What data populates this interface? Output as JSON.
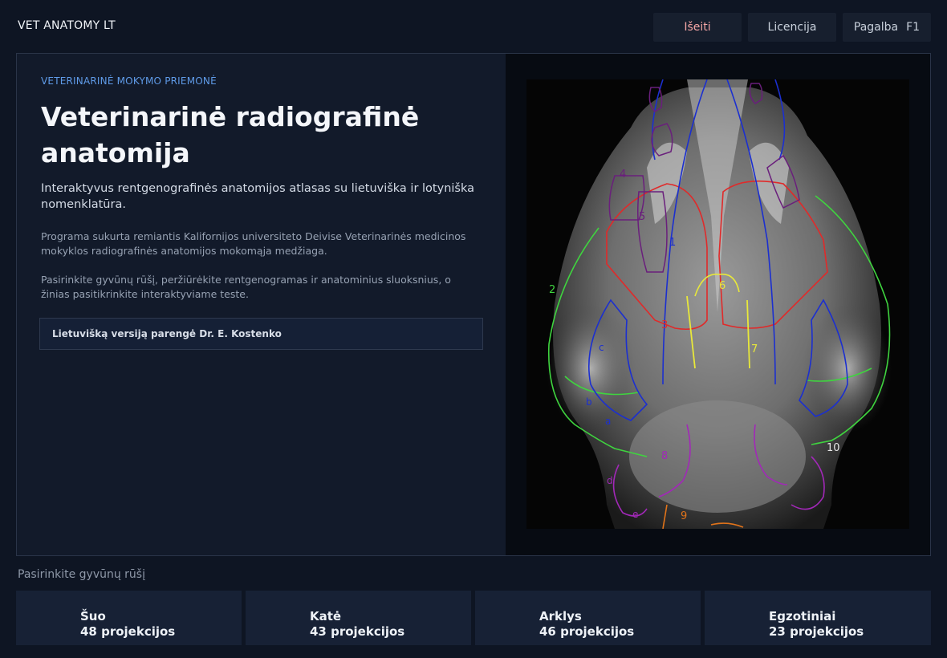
{
  "app": {
    "title": "VET ANATOMY LT"
  },
  "toolbar": {
    "exit_label": "Išeiti",
    "license_label": "Licencija",
    "help_label": "Pagalba",
    "help_key": "F1"
  },
  "intro": {
    "eyebrow": "VETERINARINĖ MOKYMO PRIEMONĖ",
    "title": "Veterinarinė radiografinė anatomija",
    "lead": "Interaktyvus rentgenografinės anatomijos atlasas su lietuviška ir lotyniška nomenklatūra.",
    "para1": "Programa sukurta remiantis Kalifornijos universiteto Deivise Veterinarinės medicinos mokyklos radiografinės anatomijos mokomąja medžiaga.",
    "para2": "Pasirinkite gyvūnų rūšį, peržiūrėkite rentgenogramas ir anatominius sluoksnius, o žinias pasitikrinkite interaktyviame teste.",
    "credit": "Lietuvišką versiją parengė Dr. E. Kostenko"
  },
  "xray": {
    "labels": [
      "1",
      "2",
      "3",
      "4",
      "5",
      "6",
      "7",
      "8",
      "9",
      "10",
      "a",
      "b",
      "c",
      "d",
      "e"
    ],
    "colors": {
      "green": "#3fd43f",
      "red": "#e02a2a",
      "blue": "#1b2fd0",
      "purple": "#6a1f7c",
      "magenta": "#a228b8",
      "yellow": "#e8e83a",
      "orange": "#e0731a"
    }
  },
  "species": {
    "label": "Pasirinkite gyvūnų rūšį",
    "items": [
      {
        "name": "Šuo",
        "count": "48 projekcijos"
      },
      {
        "name": "Katė",
        "count": "43 projekcijos"
      },
      {
        "name": "Arklys",
        "count": "46 projekcijos"
      },
      {
        "name": "Egzotiniai",
        "count": "23 projekcijos"
      }
    ]
  },
  "theme": {
    "background": "#0e1523",
    "panel": "#121a2a",
    "accent": "#5f9be8",
    "exit": "#f3a5a5"
  }
}
